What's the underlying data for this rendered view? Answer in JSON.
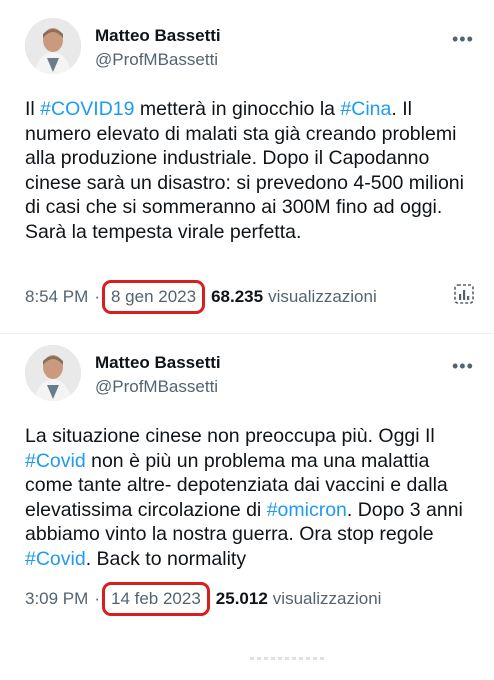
{
  "tweets": [
    {
      "author_name": "Matteo Bassetti",
      "author_handle": "@ProfMBassetti",
      "more_label": "•••",
      "body": [
        {
          "t": "Il ",
          "tag": false
        },
        {
          "t": "#COVID19",
          "tag": true
        },
        {
          "t": " metterà in ginocchio la ",
          "tag": false
        },
        {
          "t": "#Cina",
          "tag": true
        },
        {
          "t": ". Il numero elevato di malati sta già creando problemi alla produzione industriale. Dopo il Capodanno cinese sarà un disastro: si prevedono 4-500 milioni di casi che si sommeranno ai 300M fino ad oggi. Sarà la tempesta virale perfetta.",
          "tag": false
        }
      ],
      "time": "8:54 PM",
      "separator": "·",
      "date": "8 gen 2023",
      "views_count": "68.235",
      "views_label": "visualizzazioni"
    },
    {
      "author_name": "Matteo Bassetti",
      "author_handle": "@ProfMBassetti",
      "more_label": "•••",
      "body": [
        {
          "t": "La situazione cinese  non preoccupa più. Oggi Il ",
          "tag": false
        },
        {
          "t": "#Covid",
          "tag": true
        },
        {
          "t": " non è più un problema ma una malattia come tante altre- depotenziata dai vaccini e dalla elevatissima circolazione di ",
          "tag": false
        },
        {
          "t": "#omicron",
          "tag": true
        },
        {
          "t": ". Dopo 3 anni abbiamo vinto la nostra guerra. Ora stop regole ",
          "tag": false
        },
        {
          "t": "#Covid",
          "tag": true
        },
        {
          "t": ". Back to normality",
          "tag": false
        }
      ],
      "time": "3:09 PM",
      "separator": "·",
      "date": "14 feb 2023",
      "views_count": "25.012",
      "views_label": "visualizzazioni"
    }
  ],
  "colors": {
    "hashtag": "#1d9bf0",
    "muted": "#536471",
    "highlight_box": "#d81e1e"
  },
  "icons": {
    "analytics": "analytics-icon",
    "more": "more-icon"
  }
}
